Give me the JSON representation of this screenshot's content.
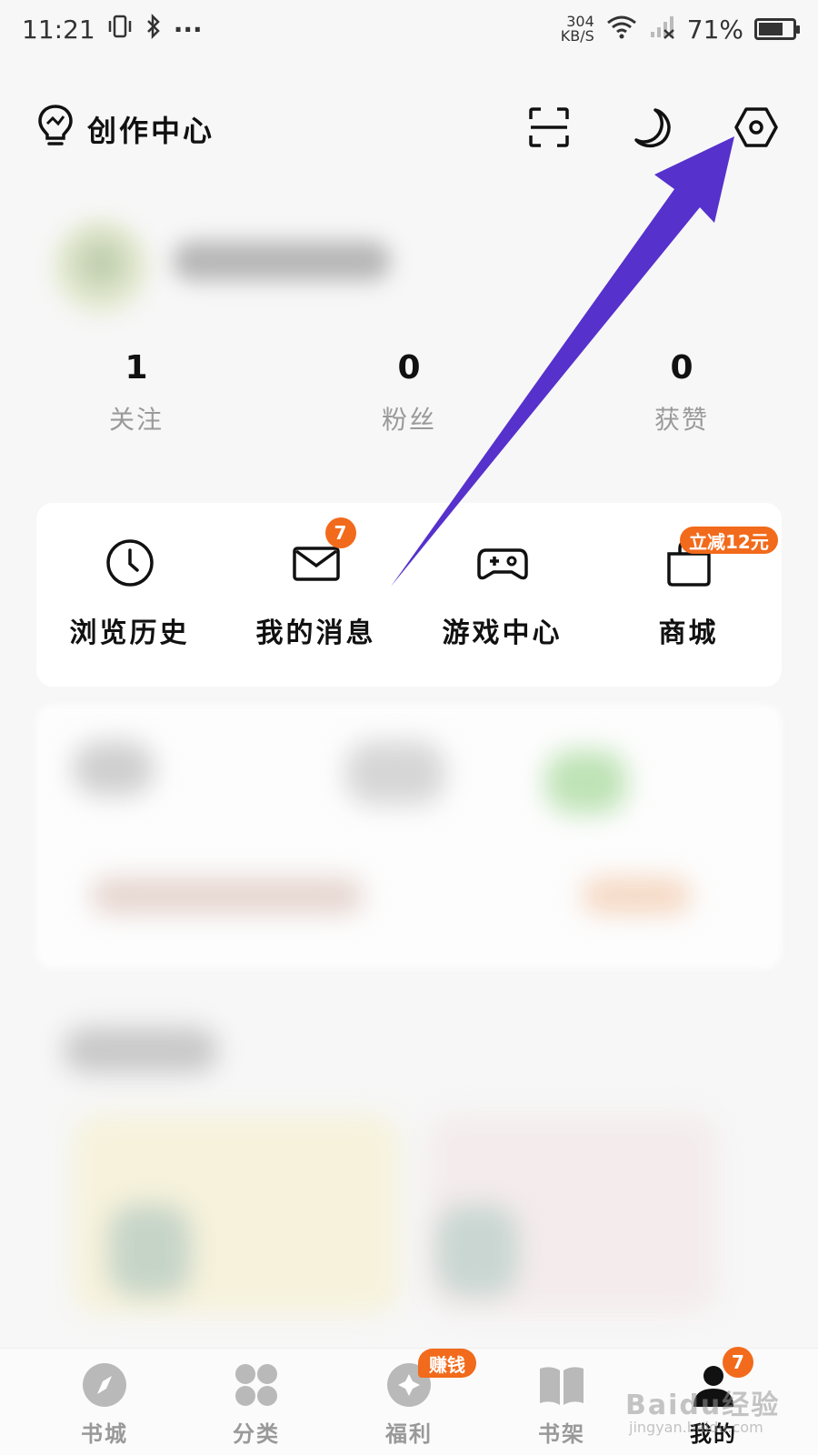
{
  "status_bar": {
    "time": "11:21",
    "more": "···",
    "net_speed_value": "304",
    "net_speed_unit": "KB/S",
    "battery": "71%",
    "battery_level": 0.71
  },
  "header": {
    "title": "创作中心"
  },
  "stats": [
    {
      "value": "1",
      "label": "关注"
    },
    {
      "value": "0",
      "label": "粉丝"
    },
    {
      "value": "0",
      "label": "获赞"
    }
  ],
  "quick_actions": [
    {
      "label": "浏览历史",
      "icon": "clock-icon"
    },
    {
      "label": "我的消息",
      "icon": "mail-icon",
      "badge": "7"
    },
    {
      "label": "游戏中心",
      "icon": "gamepad-icon"
    },
    {
      "label": "商城",
      "icon": "shopping-bag-icon",
      "badge": "立减12元"
    }
  ],
  "bottom_nav": [
    {
      "label": "书城",
      "icon": "compass-icon"
    },
    {
      "label": "分类",
      "icon": "grid-icon"
    },
    {
      "label": "福利",
      "icon": "gift-icon",
      "badge": "赚钱"
    },
    {
      "label": "书架",
      "icon": "book-icon"
    },
    {
      "label": "我的",
      "icon": "user-icon",
      "badge": "7",
      "active": true
    }
  ],
  "watermark": {
    "text": "Baidu经验",
    "sub": "jingyan.baidu.com"
  },
  "colors": {
    "accent": "#f26a1b",
    "arrow": "#5631cc",
    "background": "#f7f7f7"
  }
}
